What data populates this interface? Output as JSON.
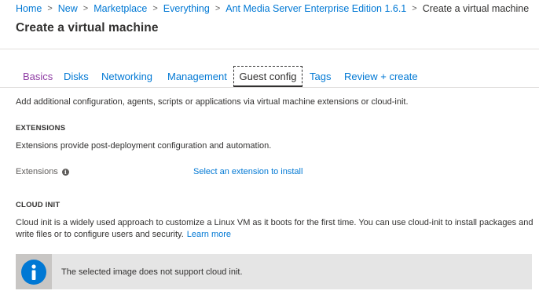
{
  "breadcrumb": [
    {
      "label": "Home"
    },
    {
      "label": "New"
    },
    {
      "label": "Marketplace"
    },
    {
      "label": "Everything"
    },
    {
      "label": "Ant Media Server Enterprise Edition 1.6.1"
    }
  ],
  "breadcrumb_current": "Create a virtual machine",
  "page_title": "Create a virtual machine",
  "tabs": {
    "basics": "Basics",
    "disks": "Disks",
    "networking": "Networking",
    "management": "Management",
    "guest_config": "Guest config",
    "tags": "Tags",
    "review_create": "Review + create"
  },
  "active_tab": "Guest config",
  "intro_text": "Add additional configuration, agents, scripts or applications via virtual machine extensions or cloud-init.",
  "extensions": {
    "heading": "EXTENSIONS",
    "description": "Extensions provide post-deployment configuration and automation.",
    "label": "Extensions",
    "link": "Select an extension to install"
  },
  "cloud_init": {
    "heading": "CLOUD INIT",
    "description": "Cloud init is a widely used approach to customize a Linux VM as it boots for the first time. You can use cloud-init to install packages and write files or to configure users and security.",
    "learn_more": "Learn more"
  },
  "info_banner": {
    "message": "The selected image does not support cloud init.",
    "icon": "info-icon"
  },
  "colors": {
    "link": "#0078d4",
    "visited_tab": "#8f3da4",
    "text": "#323130",
    "banner_bg": "#e5e5e5",
    "banner_icon_bg": "#c8c6c4"
  }
}
